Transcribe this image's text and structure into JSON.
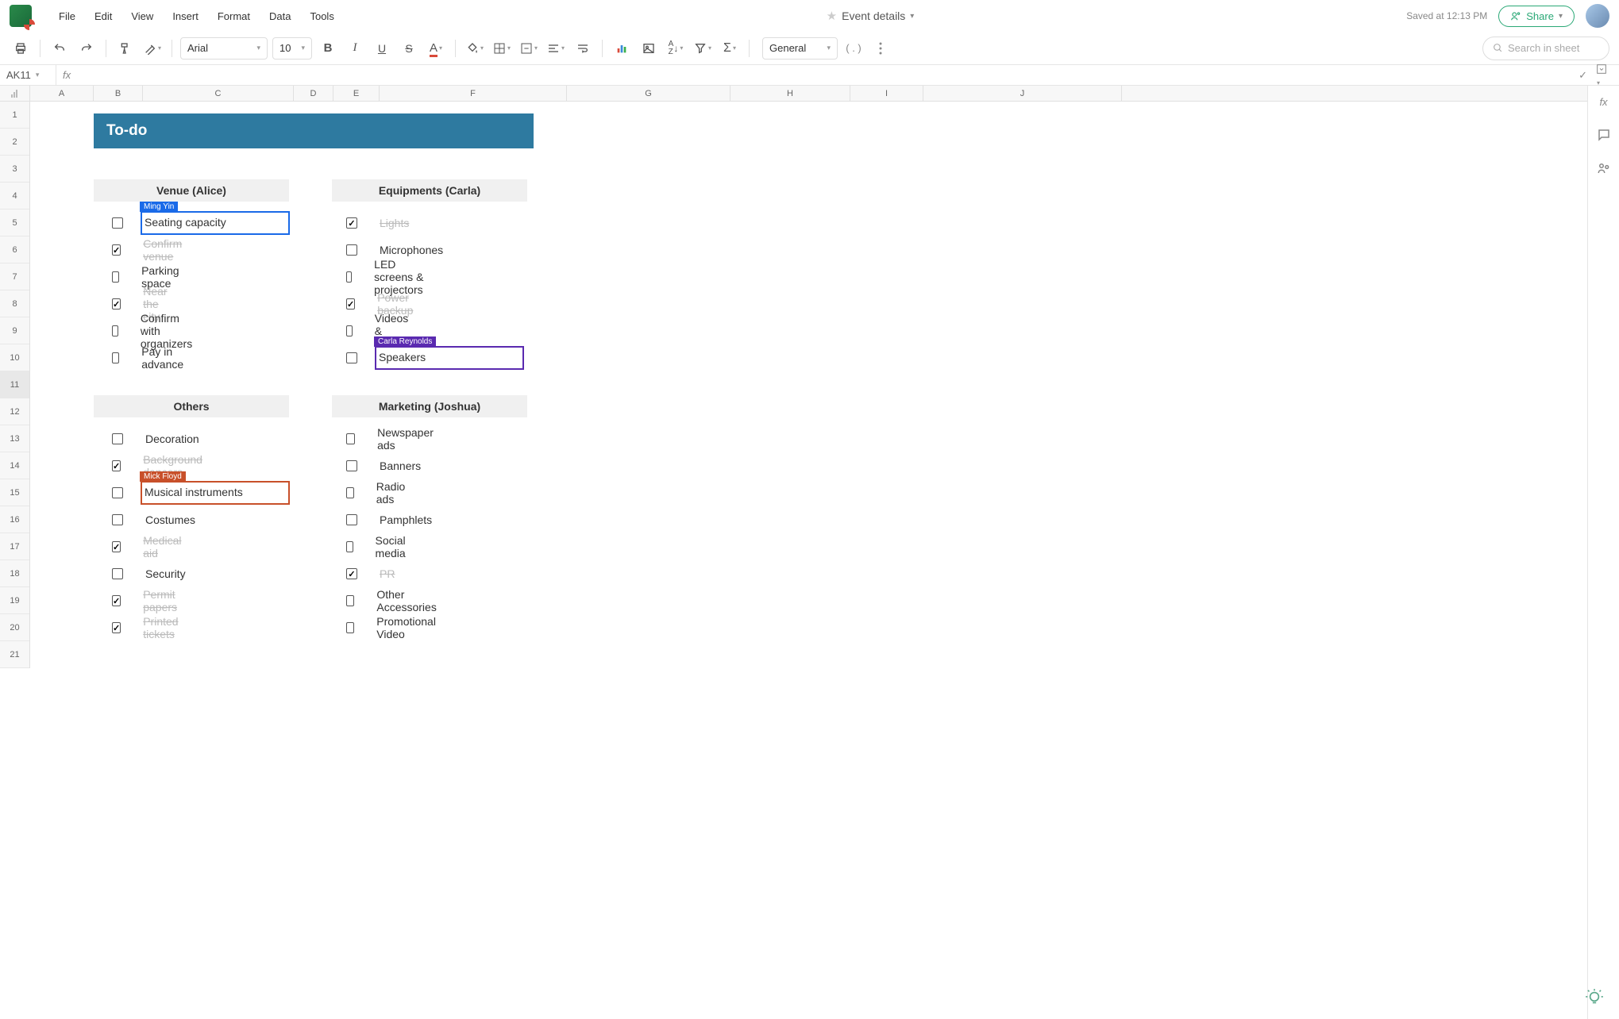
{
  "doc": {
    "title": "Event details",
    "saved": "Saved at 12:13 PM"
  },
  "menu": {
    "file": "File",
    "edit": "Edit",
    "view": "View",
    "insert": "Insert",
    "format": "Format",
    "data": "Data",
    "tools": "Tools"
  },
  "toolbar": {
    "font": "Arial",
    "size": "10",
    "number_format": "General",
    "search_placeholder": "Search in sheet",
    "share": "Share"
  },
  "formula": {
    "cell_ref": "AK11"
  },
  "columns": [
    "A",
    "B",
    "C",
    "D",
    "E",
    "F",
    "G",
    "H",
    "I",
    "J"
  ],
  "rows": [
    "1",
    "2",
    "3",
    "4",
    "5",
    "6",
    "7",
    "8",
    "9",
    "10",
    "11",
    "12",
    "13",
    "14",
    "15",
    "16",
    "17",
    "18",
    "19",
    "20",
    "21"
  ],
  "selected_row": "11",
  "sheet": {
    "title": "To-do",
    "sections": [
      {
        "id": "venue",
        "header": "Venue (Alice)",
        "col": "left",
        "row": 4,
        "tasks": [
          {
            "text": "Seating capacity",
            "checked": false,
            "user": {
              "name": "Ming Yin",
              "color": "#1a6ae8"
            }
          },
          {
            "text": "Confirm venue",
            "checked": true
          },
          {
            "text": "Parking space",
            "checked": false
          },
          {
            "text": "Near the city",
            "checked": true
          },
          {
            "text": "Confirm with organizers",
            "checked": false
          },
          {
            "text": "Pay in advance",
            "checked": false
          }
        ]
      },
      {
        "id": "equipments",
        "header": "Equipments (Carla)",
        "col": "right",
        "row": 4,
        "tasks": [
          {
            "text": "Lights",
            "checked": true
          },
          {
            "text": "Microphones",
            "checked": false
          },
          {
            "text": "LED screens & projectors",
            "checked": false
          },
          {
            "text": "Power backup",
            "checked": true
          },
          {
            "text": "Videos & photos",
            "checked": false
          },
          {
            "text": "Speakers",
            "checked": false,
            "user": {
              "name": "Carla Reynolds",
              "color": "#5a2ab0"
            }
          }
        ]
      },
      {
        "id": "others",
        "header": "Others",
        "col": "left",
        "row": 12,
        "tasks": [
          {
            "text": "Decoration",
            "checked": false
          },
          {
            "text": "Background dancers",
            "checked": true
          },
          {
            "text": "Musical instruments",
            "checked": false,
            "user": {
              "name": "Mick Floyd",
              "color": "#c8502a"
            }
          },
          {
            "text": "Costumes",
            "checked": false
          },
          {
            "text": "Medical aid",
            "checked": true
          },
          {
            "text": "Security",
            "checked": false
          },
          {
            "text": "Permit papers",
            "checked": true
          },
          {
            "text": "Printed tickets",
            "checked": true
          }
        ]
      },
      {
        "id": "marketing",
        "header": "Marketing (Joshua)",
        "col": "right",
        "row": 12,
        "tasks": [
          {
            "text": "Newspaper ads",
            "checked": false
          },
          {
            "text": "Banners",
            "checked": false
          },
          {
            "text": "Radio ads",
            "checked": false
          },
          {
            "text": "Pamphlets",
            "checked": false
          },
          {
            "text": "Social media",
            "checked": false
          },
          {
            "text": "PR",
            "checked": true
          },
          {
            "text": "Other Accessories",
            "checked": false
          },
          {
            "text": "Promotional Video",
            "checked": false
          }
        ]
      }
    ]
  }
}
